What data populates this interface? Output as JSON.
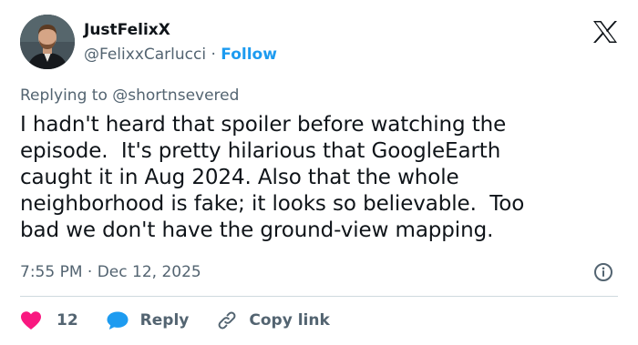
{
  "author": {
    "display_name": "JustFelixX",
    "handle": "@FelixxCarlucci",
    "separator": "·",
    "follow_label": "Follow"
  },
  "reply_to": "Replying to @shortnsevered",
  "tweet": {
    "text": "I hadn't heard that spoiler before watching the\nepisode.  It's pretty hilarious that GoogleEarth\ncaught it in Aug 2024. Also that the whole\nneighborhood is fake; it looks so believable.  Too\nbad we don't have the ground-view mapping.",
    "timestamp": "7:55 PM · Dec 12, 2025"
  },
  "actions": {
    "like_count": "12",
    "reply_label": "Reply",
    "copy_label": "Copy link"
  },
  "icons": {
    "brand": "x-logo-icon",
    "like": "heart-icon",
    "reply": "speech-bubble-icon",
    "copy": "link-icon",
    "info": "info-icon"
  },
  "colors": {
    "accent": "#1d9bf0",
    "like": "#f91880",
    "secondary_text": "#536471"
  }
}
